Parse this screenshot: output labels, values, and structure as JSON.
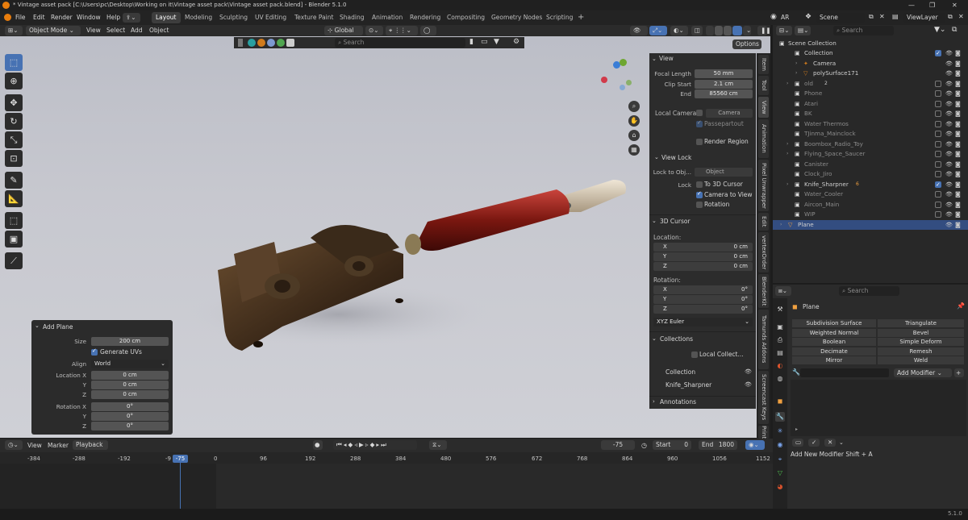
{
  "app": {
    "title": "* Vintage asset pack [C:\\Users\\pc\\Desktop\\Working on it\\Vintage asset pack\\Vintage asset pack.blend] - Blender 5.1.0",
    "version": "5.1.0"
  },
  "menu": [
    "File",
    "Edit",
    "Render",
    "Window",
    "Help"
  ],
  "workspaces": [
    "Layout",
    "Modeling",
    "Sculpting",
    "UV Editing",
    "Texture Paint",
    "Shading",
    "Animation",
    "Rendering",
    "Compositing",
    "Geometry Nodes",
    "Scripting"
  ],
  "header_right": {
    "ar": "AR",
    "scene": "Scene",
    "viewlayer": "ViewLayer"
  },
  "viewport_header": {
    "mode": "Object Mode",
    "menus": [
      "View",
      "Select",
      "Add",
      "Object"
    ],
    "orientation": "Global",
    "options": "Options"
  },
  "viewport_sub": {
    "search_placeholder": "Search"
  },
  "npanel": {
    "view_title": "View",
    "focal_length_label": "Focal Length",
    "focal_length": "50 mm",
    "clip_start_label": "Clip Start",
    "clip_start": "2.1 cm",
    "end_label": "End",
    "clip_end": "85560 cm",
    "local_camera_label": "Local Camera",
    "camera_field": "Camera",
    "passepartout": "Passepartout",
    "render_region": "Render Region",
    "view_lock_title": "View Lock",
    "lock_to_obj_label": "Lock to Obj...",
    "object_placeholder": "Object",
    "lock_label": "Lock",
    "to_3d_cursor": "To 3D Cursor",
    "camera_to_view": "Camera to View",
    "rotation_lock": "Rotation",
    "cursor_title": "3D Cursor",
    "location_label": "Location:",
    "rotation_label": "Rotation:",
    "cursor_x": "0 cm",
    "cursor_y": "0 cm",
    "cursor_z": "0 cm",
    "rot_x": "0°",
    "rot_y": "0°",
    "rot_z": "0°",
    "euler": "XYZ Euler",
    "x": "X",
    "y": "Y",
    "z": "Z",
    "collections_title": "Collections",
    "local_collect": "Local Collect...",
    "collection": "Collection",
    "knife": "Knife_Sharpner",
    "annotations_title": "Annotations"
  },
  "vtabs": [
    "Item",
    "Tool",
    "View",
    "Animation",
    "Pixel Unwrapper",
    "Edit",
    "vertexOrder",
    "BlenderKit",
    "Tamunds Addons",
    "Screencast Keys",
    "Print"
  ],
  "operator_panel": {
    "title": "Add Plane",
    "size_label": "Size",
    "size": "200 cm",
    "gen_uvs": "Generate UVs",
    "align_label": "Align",
    "align": "World",
    "loc_label": "Location X",
    "y_label": "Y",
    "z_label": "Z",
    "loc_x": "0 cm",
    "loc_y": "0 cm",
    "loc_z": "0 cm",
    "rot_label": "Rotation X",
    "rot_x": "0°",
    "rot_y": "0°",
    "rot_z": "0°"
  },
  "outliner": {
    "search_placeholder": "Search",
    "scene_collection": "Scene Collection",
    "rows": [
      {
        "name": "Collection"
      },
      {
        "name": "Camera"
      },
      {
        "name": "polySurface171"
      },
      {
        "name": "old"
      },
      {
        "name": "Phone"
      },
      {
        "name": "Atari"
      },
      {
        "name": "BK"
      },
      {
        "name": "Water Thermos"
      },
      {
        "name": "TJinma_Mainclock"
      },
      {
        "name": "Boombox_Radio_Toy"
      },
      {
        "name": "Flying_Space_Saucer"
      },
      {
        "name": "Canister"
      },
      {
        "name": "Clock_Jiro"
      },
      {
        "name": "Knife_Sharpner"
      },
      {
        "name": "Water_Cooler"
      },
      {
        "name": "Aircon_Main"
      },
      {
        "name": "WIP"
      },
      {
        "name": "Plane"
      }
    ],
    "old_count": "2",
    "knife_count": "6"
  },
  "properties": {
    "search_placeholder": "Search",
    "object_name": "Plane",
    "modifiers": [
      "Subdivision Surface",
      "Triangulate",
      "Weighted Normal",
      "Bevel",
      "Boolean",
      "Simple Deform",
      "Decimate",
      "Remesh",
      "Mirror",
      "Weld"
    ],
    "add_modifier": "Add Modifier",
    "hint": "Add New Modifier Shift + A"
  },
  "timeline": {
    "menus": [
      "View",
      "Marker",
      "Playback"
    ],
    "current_frame": "-75",
    "start_label": "Start",
    "start": "0",
    "end_label": "End",
    "end": "1800",
    "ticks": [
      "-384",
      "-288",
      "-192",
      "-9",
      "-75",
      "0",
      "96",
      "192",
      "288",
      "384",
      "480",
      "576",
      "672",
      "768",
      "864",
      "960",
      "1056",
      "1152"
    ]
  }
}
